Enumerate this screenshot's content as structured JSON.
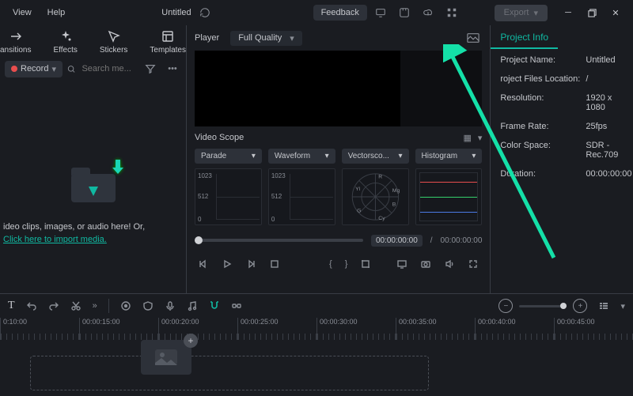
{
  "titlebar": {
    "menus": [
      "View",
      "Help"
    ],
    "title": "Untitled",
    "feedback": "Feedback",
    "export": "Export"
  },
  "toolbar": {
    "items": [
      "ansitions",
      "Effects",
      "Stickers",
      "Templates"
    ]
  },
  "media": {
    "record": "Record",
    "search_placeholder": "Search me...",
    "import_line1": "ideo clips, images, or audio here! Or,",
    "import_link": "Click here to import media."
  },
  "player": {
    "label": "Player",
    "quality": "Full Quality",
    "tc_cur": "00:00:00:00",
    "tc_sep": "/",
    "tc_dur": "00:00:00:00"
  },
  "scope": {
    "title": "Video Scope",
    "dropdowns": [
      "Parade",
      "Waveform",
      "Vectorsco...",
      "Histogram"
    ],
    "wf_labels": [
      "1023",
      "512",
      "0"
    ],
    "vec_labels": [
      "R",
      "Mg",
      "B",
      "Cy",
      "G",
      "Yl"
    ]
  },
  "project_info": {
    "tab": "Project Info",
    "rows": [
      {
        "k": "Project Name:",
        "v": "Untitled"
      },
      {
        "k": "roject Files Location:",
        "v": "/"
      },
      {
        "k": "Resolution:",
        "v": "1920 x 1080"
      },
      {
        "k": "Frame Rate:",
        "v": "25fps"
      },
      {
        "k": "Color Space:",
        "v": "SDR - Rec.709"
      },
      {
        "k": "Duration:",
        "v": "00:00:00:00"
      }
    ]
  },
  "timeline": {
    "ticks": [
      "0:10:00",
      "00:00:15:00",
      "00:00:20:00",
      "00:00:25:00",
      "00:00:30:00",
      "00:00:35:00",
      "00:00:40:00",
      "00:00:45:00"
    ]
  }
}
